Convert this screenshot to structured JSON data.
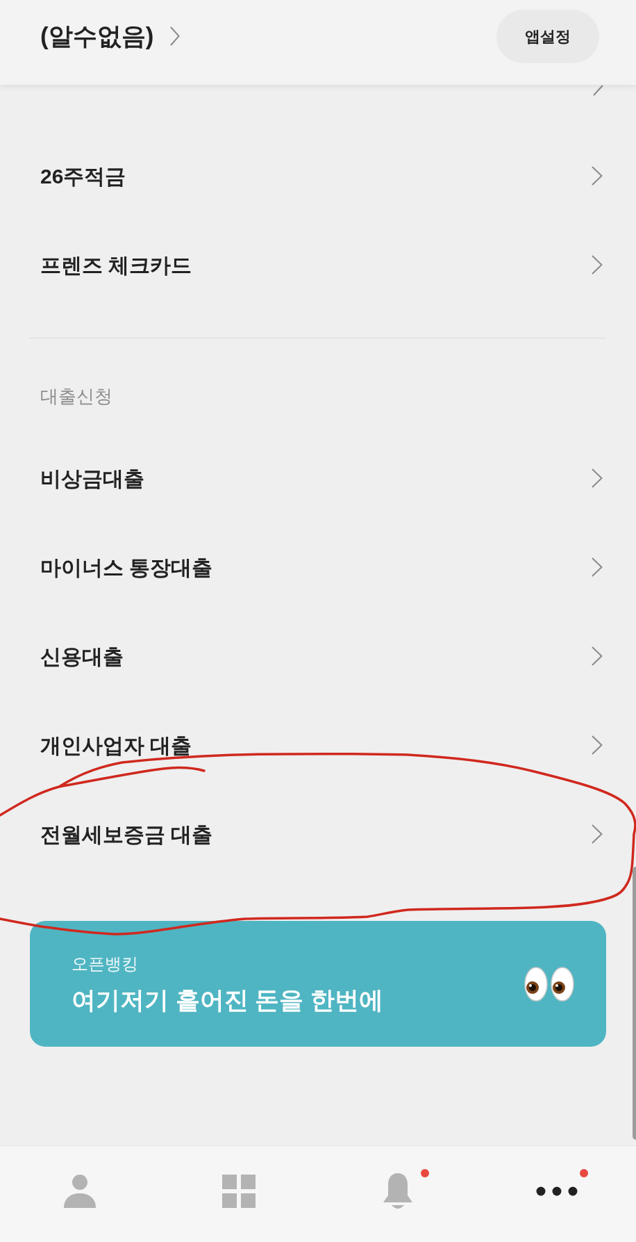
{
  "header": {
    "title": "(알수없음)",
    "settings_button": "앱설정"
  },
  "sections": [
    {
      "cut_off_item": true,
      "items": [
        {
          "label": "26주적금",
          "circled": false
        },
        {
          "label": "프렌즈 체크카드",
          "circled": false
        }
      ]
    },
    {
      "title": "대출신청",
      "items": [
        {
          "label": "비상금대출",
          "circled": false
        },
        {
          "label": "마이너스 통장대출",
          "circled": false
        },
        {
          "label": "신용대출",
          "circled": false
        },
        {
          "label": "개인사업자 대출",
          "circled": false
        },
        {
          "label": "전월세보증금 대출",
          "circled": true
        }
      ]
    }
  ],
  "banner": {
    "label": "오픈뱅킹",
    "headline": "여기저기 흩어진 돈을 한번에"
  },
  "bottom_nav": [
    {
      "kind": "profile",
      "selected": false,
      "badge": false
    },
    {
      "kind": "apps",
      "selected": false,
      "badge": false
    },
    {
      "kind": "notifications",
      "selected": false,
      "badge": true
    },
    {
      "kind": "more",
      "selected": true,
      "badge": true
    }
  ]
}
